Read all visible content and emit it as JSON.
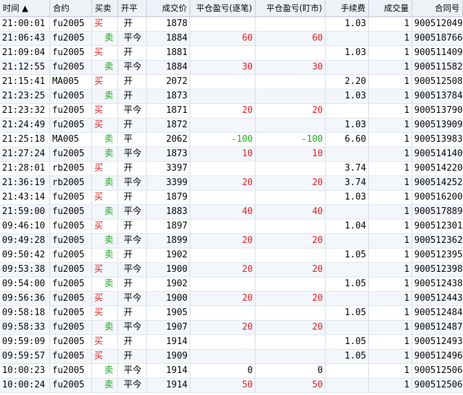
{
  "columns": {
    "time": "时间 ▲",
    "symbol": "合约",
    "side": "买卖",
    "open_close": "开平",
    "price": "成交价",
    "pl_by_trade": "平仓盈亏(逐笔)",
    "pl_mark": "平仓盈亏(盯市)",
    "fee": "手续费",
    "qty": "成交量",
    "order": "合同号"
  },
  "colors": {
    "buy": "#e01b1b",
    "sell": "#1ca51c",
    "header_bg": "#eef1f5",
    "row_alt": "#f3f6fb"
  },
  "rows": [
    {
      "time": "21:00:01",
      "symbol": "fu2005",
      "side": "买",
      "oc": "开",
      "price": "1878",
      "pl1": "",
      "pl2": "",
      "fee": "1.03",
      "qty": "1",
      "order": "900512049"
    },
    {
      "time": "21:06:43",
      "symbol": "fu2005",
      "side": "卖",
      "oc": "平今",
      "price": "1884",
      "pl1": "60",
      "pl2": "60",
      "fee": "",
      "qty": "1",
      "order": "900518766"
    },
    {
      "time": "21:09:04",
      "symbol": "fu2005",
      "side": "买",
      "oc": "开",
      "price": "1881",
      "pl1": "",
      "pl2": "",
      "fee": "1.03",
      "qty": "1",
      "order": "900511409"
    },
    {
      "time": "21:12:55",
      "symbol": "fu2005",
      "side": "卖",
      "oc": "平今",
      "price": "1884",
      "pl1": "30",
      "pl2": "30",
      "fee": "",
      "qty": "1",
      "order": "900511582"
    },
    {
      "time": "21:15:41",
      "symbol": "MA005",
      "side": "买",
      "oc": "开",
      "price": "2072",
      "pl1": "",
      "pl2": "",
      "fee": "2.20",
      "qty": "1",
      "order": "900512508"
    },
    {
      "time": "21:23:25",
      "symbol": "fu2005",
      "side": "卖",
      "oc": "开",
      "price": "1873",
      "pl1": "",
      "pl2": "",
      "fee": "1.03",
      "qty": "1",
      "order": "900513784"
    },
    {
      "time": "21:23:32",
      "symbol": "fu2005",
      "side": "买",
      "oc": "平今",
      "price": "1871",
      "pl1": "20",
      "pl2": "20",
      "fee": "",
      "qty": "1",
      "order": "900513790"
    },
    {
      "time": "21:24:49",
      "symbol": "fu2005",
      "side": "买",
      "oc": "开",
      "price": "1872",
      "pl1": "",
      "pl2": "",
      "fee": "1.03",
      "qty": "1",
      "order": "900513909"
    },
    {
      "time": "21:25:18",
      "symbol": "MA005",
      "side": "卖",
      "oc": "平",
      "price": "2062",
      "pl1": "-100",
      "pl2": "-100",
      "fee": "6.60",
      "qty": "1",
      "order": "900513983"
    },
    {
      "time": "21:27:24",
      "symbol": "fu2005",
      "side": "卖",
      "oc": "平今",
      "price": "1873",
      "pl1": "10",
      "pl2": "10",
      "fee": "",
      "qty": "1",
      "order": "900514140"
    },
    {
      "time": "21:28:01",
      "symbol": "rb2005",
      "side": "买",
      "oc": "开",
      "price": "3397",
      "pl1": "",
      "pl2": "",
      "fee": "3.74",
      "qty": "1",
      "order": "900514220"
    },
    {
      "time": "21:36:19",
      "symbol": "rb2005",
      "side": "卖",
      "oc": "平今",
      "price": "3399",
      "pl1": "20",
      "pl2": "20",
      "fee": "3.74",
      "qty": "1",
      "order": "900514252"
    },
    {
      "time": "21:43:14",
      "symbol": "fu2005",
      "side": "买",
      "oc": "开",
      "price": "1879",
      "pl1": "",
      "pl2": "",
      "fee": "1.03",
      "qty": "1",
      "order": "900516200"
    },
    {
      "time": "21:59:00",
      "symbol": "fu2005",
      "side": "卖",
      "oc": "平今",
      "price": "1883",
      "pl1": "40",
      "pl2": "40",
      "fee": "",
      "qty": "1",
      "order": "900517889"
    },
    {
      "time": "09:46:10",
      "symbol": "fu2005",
      "side": "买",
      "oc": "开",
      "price": "1897",
      "pl1": "",
      "pl2": "",
      "fee": "1.04",
      "qty": "1",
      "order": "900512301"
    },
    {
      "time": "09:49:28",
      "symbol": "fu2005",
      "side": "卖",
      "oc": "平今",
      "price": "1899",
      "pl1": "20",
      "pl2": "20",
      "fee": "",
      "qty": "1",
      "order": "900512362"
    },
    {
      "time": "09:50:42",
      "symbol": "fu2005",
      "side": "卖",
      "oc": "开",
      "price": "1902",
      "pl1": "",
      "pl2": "",
      "fee": "1.05",
      "qty": "1",
      "order": "900512395"
    },
    {
      "time": "09:53:38",
      "symbol": "fu2005",
      "side": "买",
      "oc": "平今",
      "price": "1900",
      "pl1": "20",
      "pl2": "20",
      "fee": "",
      "qty": "1",
      "order": "900512398"
    },
    {
      "time": "09:54:00",
      "symbol": "fu2005",
      "side": "卖",
      "oc": "开",
      "price": "1902",
      "pl1": "",
      "pl2": "",
      "fee": "1.05",
      "qty": "1",
      "order": "900512438"
    },
    {
      "time": "09:56:36",
      "symbol": "fu2005",
      "side": "买",
      "oc": "平今",
      "price": "1900",
      "pl1": "20",
      "pl2": "20",
      "fee": "",
      "qty": "1",
      "order": "900512443"
    },
    {
      "time": "09:58:18",
      "symbol": "fu2005",
      "side": "买",
      "oc": "开",
      "price": "1905",
      "pl1": "",
      "pl2": "",
      "fee": "1.05",
      "qty": "1",
      "order": "900512484"
    },
    {
      "time": "09:58:33",
      "symbol": "fu2005",
      "side": "卖",
      "oc": "平今",
      "price": "1907",
      "pl1": "20",
      "pl2": "20",
      "fee": "",
      "qty": "1",
      "order": "900512487"
    },
    {
      "time": "09:59:09",
      "symbol": "fu2005",
      "side": "买",
      "oc": "开",
      "price": "1914",
      "pl1": "",
      "pl2": "",
      "fee": "1.05",
      "qty": "1",
      "order": "900512493"
    },
    {
      "time": "09:59:57",
      "symbol": "fu2005",
      "side": "买",
      "oc": "开",
      "price": "1909",
      "pl1": "",
      "pl2": "",
      "fee": "1.05",
      "qty": "1",
      "order": "900512496"
    },
    {
      "time": "10:00:23",
      "symbol": "fu2005",
      "side": "卖",
      "oc": "平今",
      "price": "1914",
      "pl1": "0",
      "pl2": "0",
      "fee": "",
      "qty": "1",
      "order": "900512506"
    },
    {
      "time": "10:00:24",
      "symbol": "fu2005",
      "side": "卖",
      "oc": "平今",
      "price": "1914",
      "pl1": "50",
      "pl2": "50",
      "fee": "",
      "qty": "1",
      "order": "900512506"
    }
  ]
}
